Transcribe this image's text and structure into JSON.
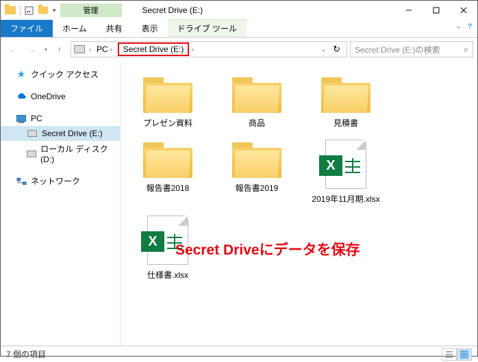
{
  "titlebar": {
    "title": "Secret Drive (E:)"
  },
  "contextual_tab": {
    "group_label": "管理",
    "tab_label": "ドライブ ツール"
  },
  "ribbon_tabs": {
    "file": "ファイル",
    "home": "ホーム",
    "share": "共有",
    "view": "表示"
  },
  "breadcrumb": {
    "pc": "PC",
    "drive": "Secret Drive (E:)"
  },
  "search": {
    "placeholder": "Secret Drive (E:)の検索"
  },
  "navpane": {
    "quick_access": "クイック アクセス",
    "onedrive": "OneDrive",
    "pc": "PC",
    "secret_drive": "Secret Drive (E:)",
    "local_disk": "ローカル ディスク (D:)",
    "network": "ネットワーク"
  },
  "items": [
    {
      "type": "folder",
      "name": "プレゼン資料"
    },
    {
      "type": "folder",
      "name": "商品"
    },
    {
      "type": "folder",
      "name": "見積書"
    },
    {
      "type": "folder",
      "name": "報告書2018"
    },
    {
      "type": "folder",
      "name": "報告書2019"
    },
    {
      "type": "excel",
      "name": "2019年11月期.xlsx"
    },
    {
      "type": "excel",
      "name": "仕様書.xlsx"
    }
  ],
  "annotation": "Secret Driveにデータを保存",
  "status": {
    "item_count": "7 個の項目"
  }
}
